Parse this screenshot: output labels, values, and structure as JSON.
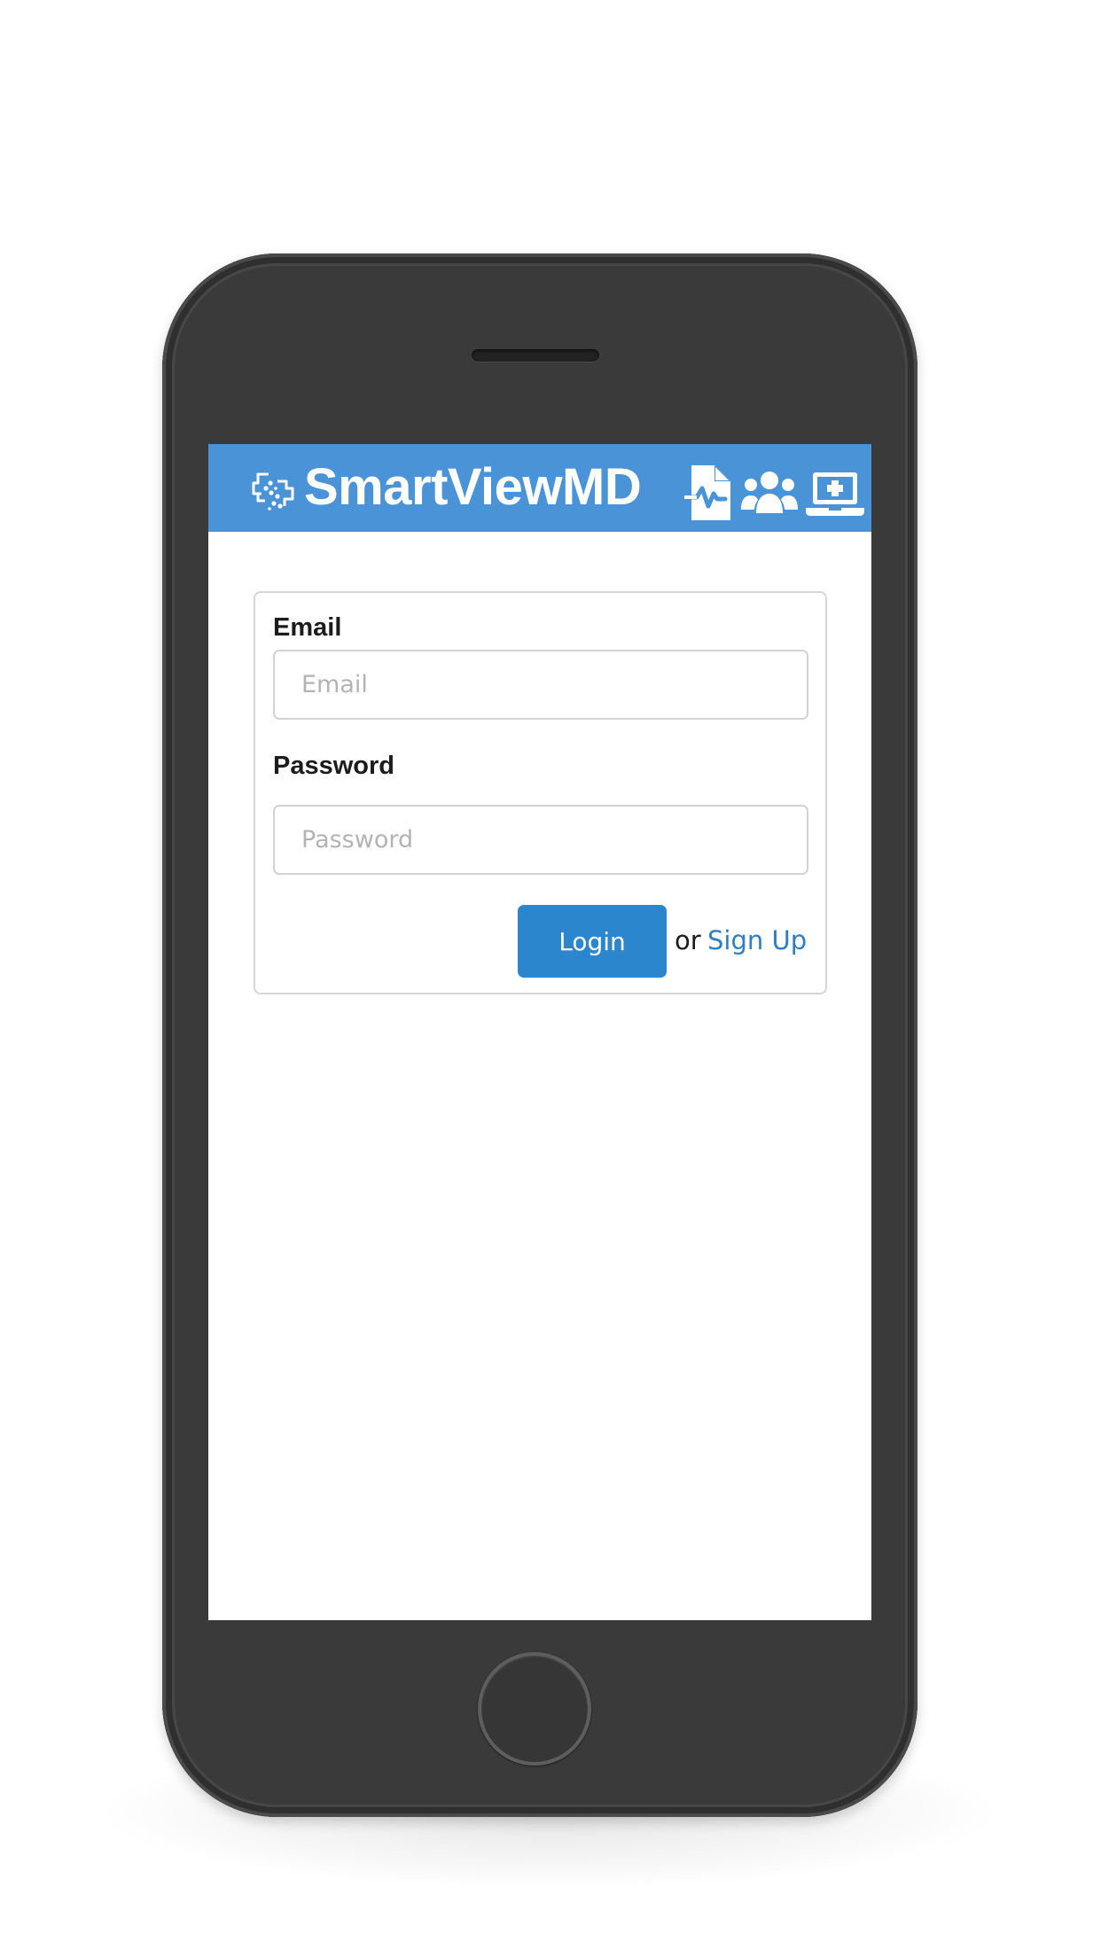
{
  "header": {
    "brand": "SmartViewMD",
    "background_color": "#4a93d6",
    "icons": [
      "logo-icon",
      "medical-report-icon",
      "users-group-icon",
      "telemedicine-laptop-icon"
    ]
  },
  "login_form": {
    "email_label": "Email",
    "email_placeholder": "Email",
    "password_label": "Password",
    "password_placeholder": "Password",
    "login_button": "Login",
    "or_text": "or",
    "signup_link": "Sign Up",
    "accent_color": "#2b86cd",
    "link_color": "#2f7ec4"
  },
  "device": {
    "frame_color": "#3a3a3a"
  }
}
